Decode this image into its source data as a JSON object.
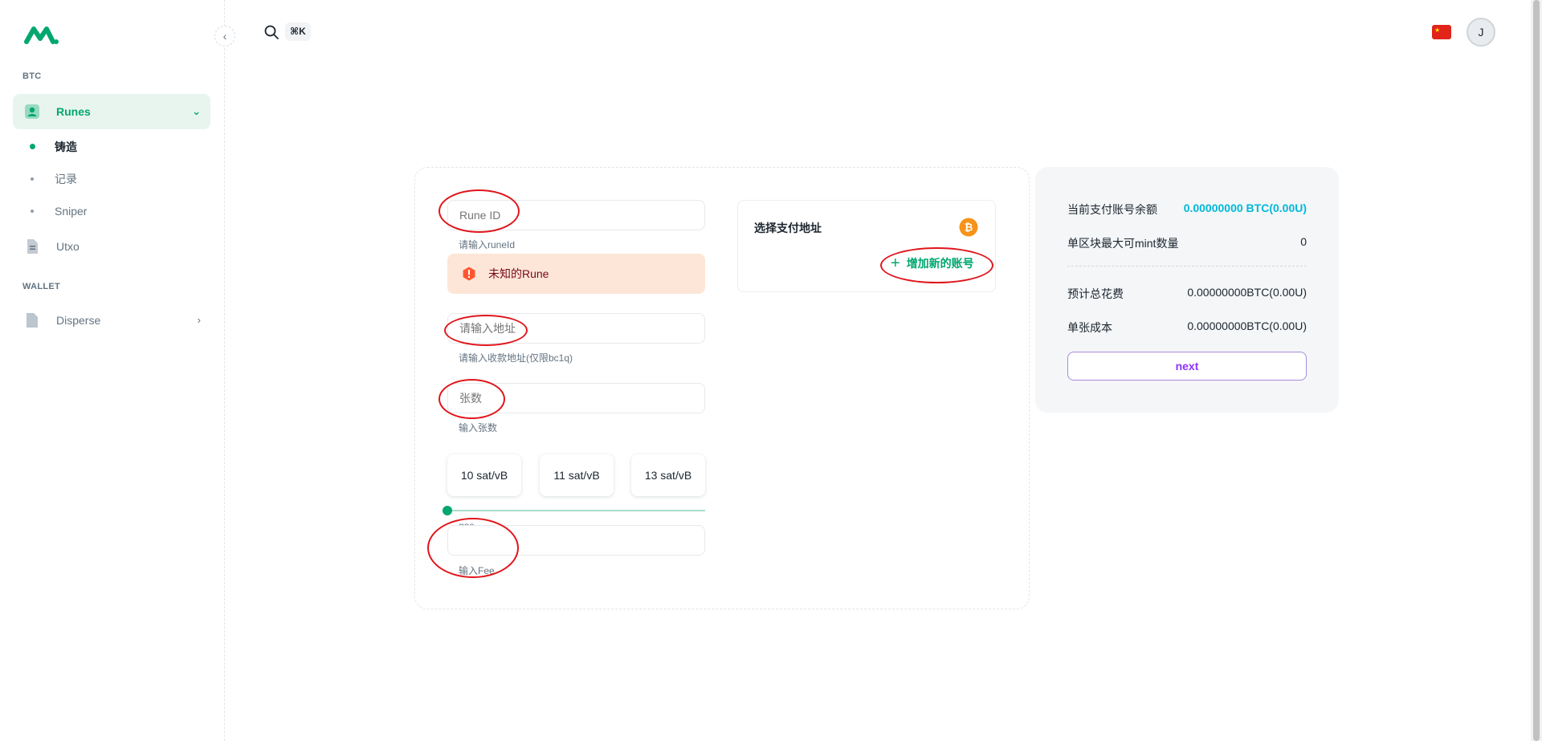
{
  "sidebar": {
    "section_btc": "BTC",
    "section_wallet": "WALLET",
    "items": [
      {
        "label": "Runes",
        "icon": "user-square-icon"
      },
      {
        "label": "Utxo",
        "icon": "file-icon"
      },
      {
        "label": "Disperse",
        "icon": "document-icon"
      }
    ],
    "runes_sub": [
      "铸造",
      "记录",
      "Sniper"
    ],
    "collapse_glyph": "‹",
    "expand_glyph": "›",
    "open_glyph": "⌄"
  },
  "header": {
    "search_shortcut": "⌘K",
    "avatar_initial": "J",
    "language_flag": "cn-flag-icon"
  },
  "form": {
    "rune_id": {
      "placeholder": "Rune ID",
      "helper": "请输入runeId"
    },
    "alert_text": "未知的Rune",
    "address": {
      "placeholder": "请输入地址",
      "helper": "请输入收款地址(仅限bc1q)"
    },
    "quantity": {
      "placeholder": "张数",
      "helper": "输入张数"
    },
    "gas_options": [
      "10 sat/vB",
      "11 sat/vB",
      "13 sat/vB"
    ],
    "slider_value": 0,
    "gas": {
      "label": "gas",
      "helper": "输入Fee"
    }
  },
  "payment": {
    "title": "选择支付地址",
    "add_account": "增加新的账号",
    "plus_glyph": "+"
  },
  "summary": {
    "balance_label": "当前支付账号余额",
    "balance_value": "0.00000000 BTC(0.00U)",
    "max_mint_label": "单区块最大可mint数量",
    "max_mint_value": "0",
    "total_fee_label": "预计总花费",
    "total_fee_value": "0.00000000BTC(0.00U)",
    "unit_cost_label": "单张成本",
    "unit_cost_value": "0.00000000BTC(0.00U)",
    "next_label": "next"
  },
  "colors": {
    "primary": "#00a76f",
    "accent_info": "#00b8d9",
    "next_button": "#8e33ff",
    "annotation": "#e0151b",
    "alert_bg": "#fde6d7"
  }
}
